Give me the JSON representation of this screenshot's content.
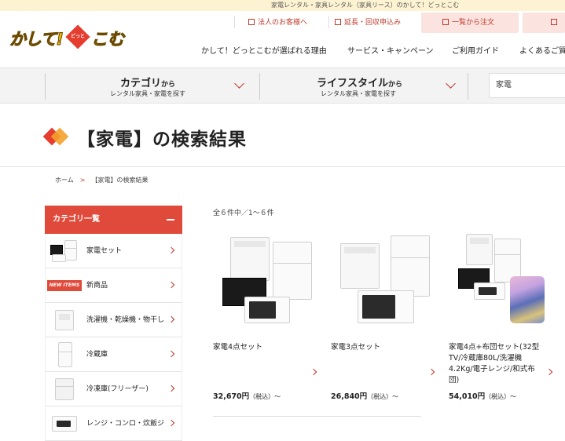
{
  "topbar": {
    "text": "家電レンタル・家具レンタル（家具リース）のかして！どっとこむ"
  },
  "logo": {
    "part1": "かして!",
    "dotto": "どっと",
    "part2": "こむ"
  },
  "utility": {
    "corporate": "法人のお客様へ",
    "extension": "延長・回収申込み",
    "list_order": "一覧から注文"
  },
  "nav": {
    "reasons": "かして！どっとこむが選ばれる理由",
    "services": "サービス・キャンペーン",
    "guide": "ご利用ガイド",
    "faq": "よくあるご質"
  },
  "category_bar": {
    "category_title": "カテゴリ",
    "category_suffix": "から",
    "category_sub": "レンタル家具・家電を探す",
    "lifestyle_title": "ライフスタイル",
    "lifestyle_suffix": "から",
    "lifestyle_sub": "レンタル家具・家電を探す",
    "search_value": "家電"
  },
  "page": {
    "title": "【家電】の検索結果"
  },
  "breadcrumb": {
    "home": "ホーム",
    "current": "【家電】の検索結果"
  },
  "sidebar": {
    "header": "カテゴリ一覧",
    "items": [
      {
        "label": "家電セット"
      },
      {
        "label": "新商品",
        "badge": "NEW ITEMS"
      },
      {
        "label": "洗濯機・乾燥機・物干し"
      },
      {
        "label": "冷蔵庫"
      },
      {
        "label": "冷凍庫(フリーザー)"
      },
      {
        "label": "レンジ・コンロ・炊飯ジ"
      }
    ]
  },
  "results": {
    "count_text": "全６件中／1～６件",
    "products": [
      {
        "name": "家電4点セット",
        "price": "32,670円",
        "tax": "（税込）～"
      },
      {
        "name": "家電3点セット",
        "price": "26,840円",
        "tax": "（税込）～"
      },
      {
        "name": "家電4点+布団セット(32型TV/冷蔵庫80L/洗濯機4.2Kg/電子レンジ/和式布団)",
        "price": "54,010円",
        "tax": "（税込）～"
      }
    ]
  },
  "colors": {
    "accent": "#e04a3a",
    "brand_yellow": "#f0b400",
    "topbar_bg": "#fdf3d2",
    "pink_button": "#fbe3df"
  }
}
